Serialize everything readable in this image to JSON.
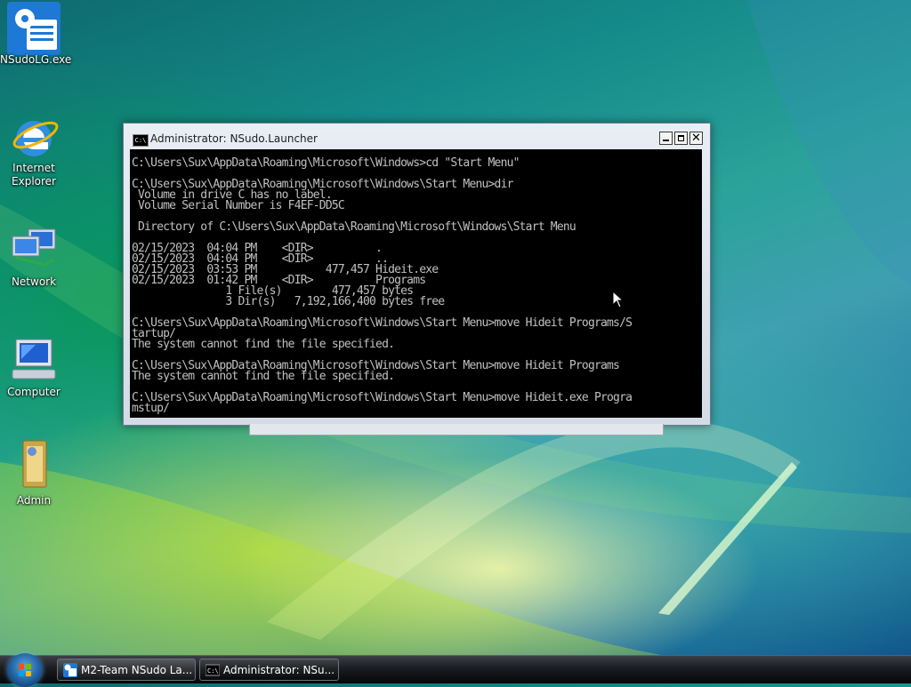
{
  "desktop": {
    "icons": [
      {
        "label": "NSudoLG.exe",
        "icon": "nsudo-gear-icon"
      },
      {
        "label": "Internet Explorer",
        "icon": "internet-explorer-icon"
      },
      {
        "label": "Network",
        "icon": "network-icon"
      },
      {
        "label": "Computer",
        "icon": "computer-icon"
      },
      {
        "label": "Admin",
        "icon": "user-folder-icon"
      }
    ]
  },
  "window": {
    "title": "Administrator: NSudo.Launcher",
    "icon": "console-icon",
    "controls": {
      "minimize": "minimize",
      "maximize": "maximize",
      "close": "✕"
    },
    "console_lines": [
      "C:\\Users\\Sux\\AppData\\Roaming\\Microsoft\\Windows>cd \"Start Menu\"",
      "",
      "C:\\Users\\Sux\\AppData\\Roaming\\Microsoft\\Windows\\Start Menu>dir",
      " Volume in drive C has no label.",
      " Volume Serial Number is F4EF-DD5C",
      "",
      " Directory of C:\\Users\\Sux\\AppData\\Roaming\\Microsoft\\Windows\\Start Menu",
      "",
      "02/15/2023  04:04 PM    <DIR>          .",
      "02/15/2023  04:04 PM    <DIR>          ..",
      "02/15/2023  03:53 PM           477,457 Hideit.exe",
      "02/15/2023  01:42 PM    <DIR>          Programs",
      "               1 File(s)        477,457 bytes",
      "               3 Dir(s)   7,192,166,400 bytes free",
      "",
      "C:\\Users\\Sux\\AppData\\Roaming\\Microsoft\\Windows\\Start Menu>move Hideit Programs/S",
      "tartup/",
      "The system cannot find the file specified.",
      "",
      "C:\\Users\\Sux\\AppData\\Roaming\\Microsoft\\Windows\\Start Menu>move Hideit Programs",
      "The system cannot find the file specified.",
      "",
      "C:\\Users\\Sux\\AppData\\Roaming\\Microsoft\\Windows\\Start Menu>move Hideit.exe Progra",
      "mstup/"
    ]
  },
  "taskbar": {
    "start_icon": "windows-start-orb-icon",
    "buttons": [
      {
        "label": "M2-Team NSudo La...",
        "icon": "nsudo-app-icon",
        "active": false
      },
      {
        "label": "Administrator: NSu...",
        "icon": "console-icon",
        "active": true
      }
    ]
  },
  "colors": {
    "console_bg": "#000000",
    "console_text": "#c0c0c0",
    "taskbar": "#1a1c20"
  }
}
